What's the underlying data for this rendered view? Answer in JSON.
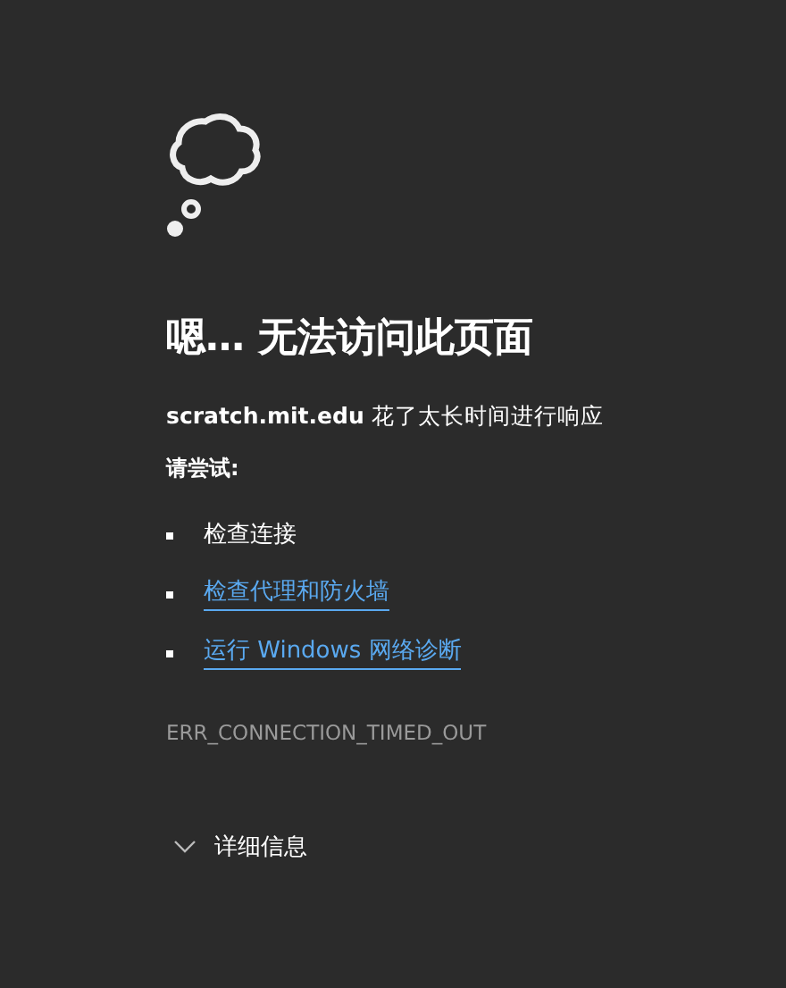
{
  "title": "嗯… 无法访问此页面",
  "message": "**scratch.mit.edu** 花了太长时间进行响应",
  "try_label": "请尝试:",
  "suggestions": [
    {
      "kind": "text",
      "text": "检查连接"
    },
    {
      "kind": "link",
      "text": "检查代理和防火墙"
    },
    {
      "kind": "link",
      "text": "运行 Windows 网络诊断"
    }
  ],
  "error_code": "ERR_CONNECTION_TIMED_OUT",
  "details": {
    "label": "详细信息",
    "expanded": false
  }
}
